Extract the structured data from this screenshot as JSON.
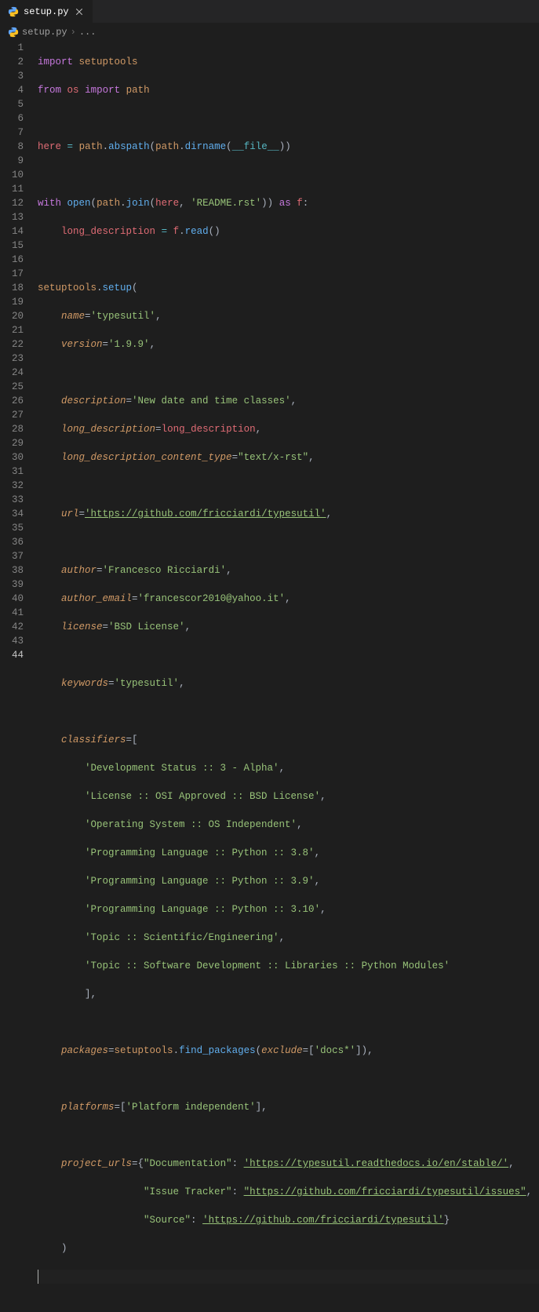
{
  "tab": {
    "filename": "setup.py",
    "icon": "python-file-icon"
  },
  "breadcrumb": {
    "filename": "setup.py",
    "separator": "›",
    "more": "..."
  },
  "editor": {
    "active_line": 44,
    "line_count": 44
  },
  "code": {
    "l1": {
      "import": "import",
      "setuptools": "setuptools"
    },
    "l2": {
      "from": "from",
      "os": "os",
      "import": "import",
      "path": "path"
    },
    "l4": {
      "here": "here",
      "eq": "=",
      "path": "path",
      "abspath": "abspath",
      "dirname": "dirname",
      "file": "__file__"
    },
    "l6": {
      "with": "with",
      "open": "open",
      "path": "path",
      "join": "join",
      "here": "here",
      "readme": "'README.rst'",
      "as": "as",
      "f": "f"
    },
    "l7": {
      "ld": "long_description",
      "eq": "=",
      "f": "f",
      "read": "read"
    },
    "l9": {
      "setuptools": "setuptools",
      "setup": "setup"
    },
    "l10": {
      "k": "name",
      "v": "'typesutil'"
    },
    "l11": {
      "k": "version",
      "v": "'1.9.9'"
    },
    "l13": {
      "k": "description",
      "v": "'New date and time classes'"
    },
    "l14": {
      "k": "long_description",
      "v": "long_description"
    },
    "l15": {
      "k": "long_description_content_type",
      "v": "\"text/x-rst\""
    },
    "l17": {
      "k": "url",
      "v": "'https://github.com/fricciardi/typesutil'"
    },
    "l19": {
      "k": "author",
      "v": "'Francesco Ricciardi'"
    },
    "l20": {
      "k": "author_email",
      "v": "'francescor2010@yahoo.it'"
    },
    "l21": {
      "k": "license",
      "v": "'BSD License'"
    },
    "l23": {
      "k": "keywords",
      "v": "'typesutil'"
    },
    "l25": {
      "k": "classifiers"
    },
    "l26": "'Development Status :: 3 - Alpha'",
    "l27": "'License :: OSI Approved :: BSD License'",
    "l28": "'Operating System :: OS Independent'",
    "l29": "'Programming Language :: Python :: 3.8'",
    "l30": "'Programming Language :: Python :: 3.9'",
    "l31": "'Programming Language :: Python :: 3.10'",
    "l32": "'Topic :: Scientific/Engineering'",
    "l33": "'Topic :: Software Development :: Libraries :: Python Modules'",
    "l36": {
      "k": "packages",
      "setuptools": "setuptools",
      "fn": "find_packages",
      "exclude": "exclude",
      "v": "'docs*'"
    },
    "l38": {
      "k": "platforms",
      "v": "'Platform independent'"
    },
    "l40": {
      "k": "project_urls",
      "doc_k": "\"Documentation\"",
      "doc_v": "'https://typesutil.readthedocs.io/en/stable/'"
    },
    "l41": {
      "k": "\"Issue Tracker\"",
      "v": "\"https://github.com/fricciardi/typesutil/issues\""
    },
    "l42": {
      "k": "\"Source\"",
      "v": "'https://github.com/fricciardi/typesutil'"
    }
  }
}
